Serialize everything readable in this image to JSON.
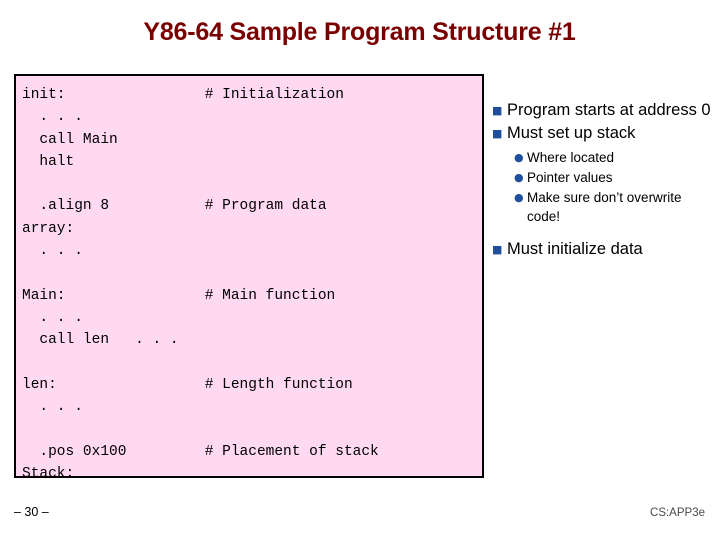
{
  "slide": {
    "title": "Y86-64 Sample Program Structure #1",
    "code": "init:                # Initialization\n  . . .\n  call Main\n  halt\n\n  .align 8           # Program data\narray:\n  . . .\n\nMain:                # Main function\n  . . .\n  call len   . . .\n\nlen:                 # Length function\n  . . .\n\n  .pos 0x100         # Placement of stack\nStack:",
    "bullets": [
      {
        "level": 1,
        "marker": "■",
        "text": "Program starts at address 0"
      },
      {
        "level": 1,
        "marker": "■",
        "text": "Must set up stack"
      },
      {
        "level": 2,
        "marker": "●",
        "text": "Where located"
      },
      {
        "level": 2,
        "marker": "●",
        "text": "Pointer values"
      },
      {
        "level": 2,
        "marker": "●",
        "text": "Make sure don’t overwrite code!"
      },
      {
        "level": 1,
        "marker": "■",
        "text": "Must initialize data"
      }
    ],
    "footer_left": "– 30 –",
    "footer_right": "CS:APP3e"
  },
  "colors": {
    "title": "#7a0000",
    "code_bg": "#ffd9f2",
    "code_border": "#000000",
    "bullet_marker": "#1f4e9c"
  }
}
